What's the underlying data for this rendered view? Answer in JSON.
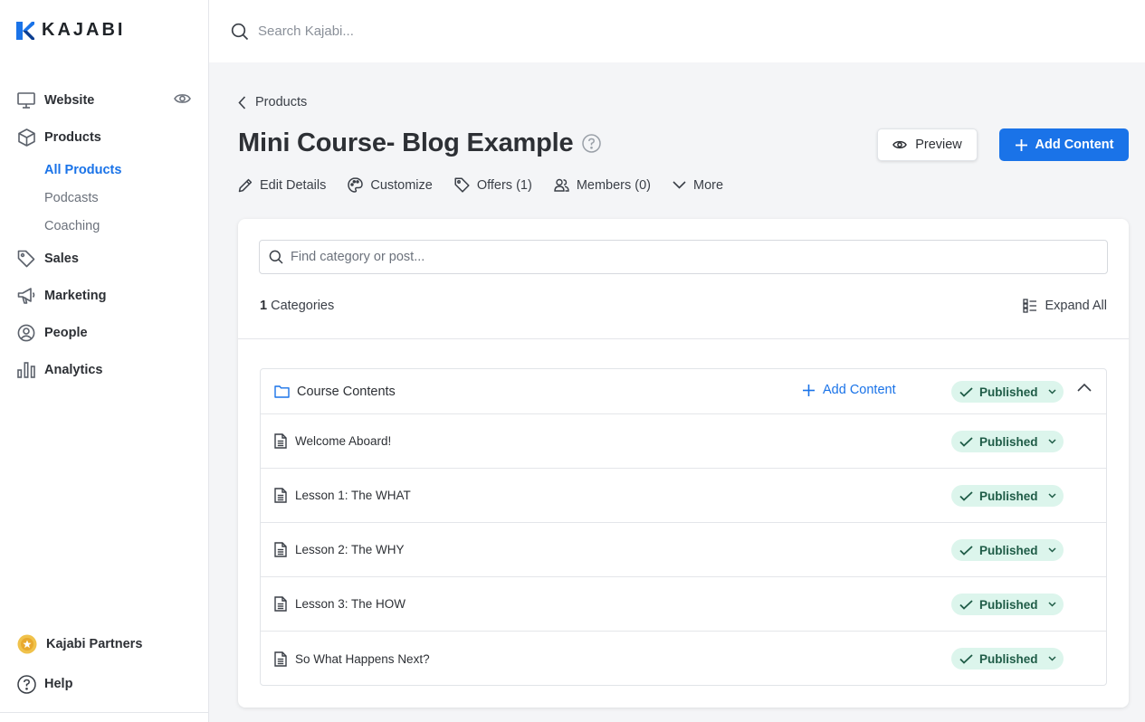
{
  "brand": {
    "name": "KAJABI",
    "accent": "#1a73e8"
  },
  "search": {
    "placeholder": "Search Kajabi..."
  },
  "sidebar": {
    "items": [
      {
        "label": "Website",
        "icon": "monitor-icon"
      },
      {
        "label": "Products",
        "icon": "box-icon"
      },
      {
        "label": "Sales",
        "icon": "tag-icon"
      },
      {
        "label": "Marketing",
        "icon": "megaphone-icon"
      },
      {
        "label": "People",
        "icon": "user-circle-icon"
      },
      {
        "label": "Analytics",
        "icon": "bar-chart-icon"
      }
    ],
    "products_sub": [
      "All Products",
      "Podcasts",
      "Coaching"
    ],
    "active_sub": "All Products",
    "bottom": [
      {
        "label": "Kajabi Partners",
        "icon": "star-badge-icon"
      },
      {
        "label": "Help",
        "icon": "question-circle-icon"
      }
    ]
  },
  "header": {
    "breadcrumb": "Products",
    "title": "Mini Course- Blog Example",
    "preview_label": "Preview",
    "add_content_label": "Add Content"
  },
  "tabs": [
    {
      "label": "Edit Details",
      "icon": "pencil-icon"
    },
    {
      "label": "Customize",
      "icon": "palette-icon"
    },
    {
      "label": "Offers (1)",
      "icon": "tag-icon"
    },
    {
      "label": "Members (0)",
      "icon": "users-icon"
    },
    {
      "label": "More",
      "icon": "chevron-down-icon"
    }
  ],
  "content": {
    "find_placeholder": "Find category or post...",
    "category_count": "1",
    "category_count_label": "Categories",
    "expand_all_label": "Expand All",
    "category": {
      "name": "Course Contents",
      "add_content_label": "Add Content",
      "status": "Published",
      "posts": [
        {
          "title": "Welcome Aboard!",
          "status": "Published"
        },
        {
          "title": "Lesson 1: The WHAT",
          "status": "Published"
        },
        {
          "title": "Lesson 2: The WHY",
          "status": "Published"
        },
        {
          "title": "Lesson 3: The HOW",
          "status": "Published"
        },
        {
          "title": "So What Happens Next?",
          "status": "Published"
        }
      ]
    }
  }
}
